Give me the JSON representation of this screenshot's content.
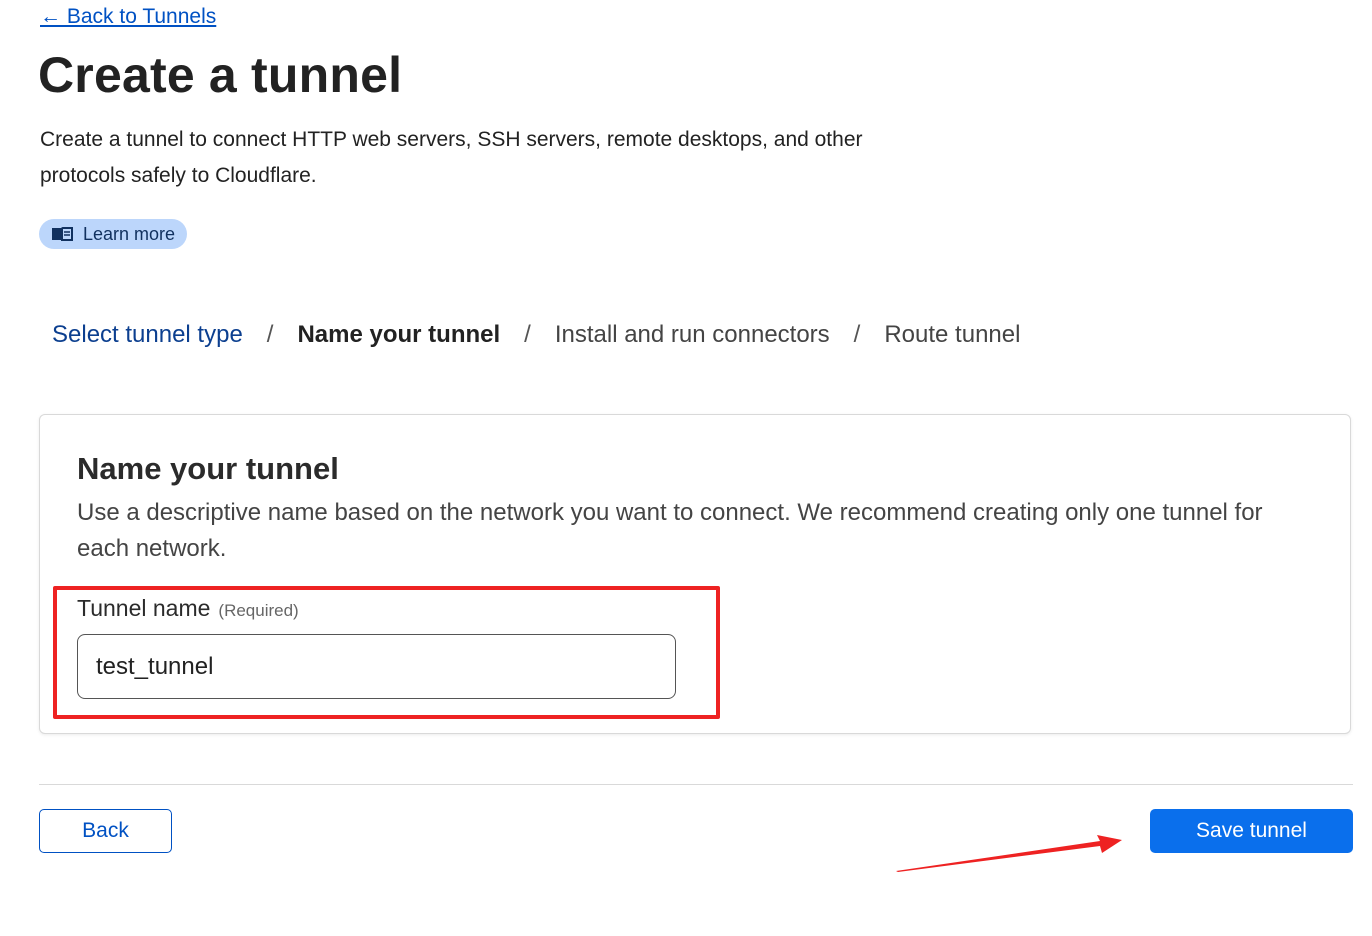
{
  "nav": {
    "back_link": "← Back to Tunnels"
  },
  "header": {
    "title": "Create a tunnel",
    "description": "Create a tunnel to connect HTTP web servers, SSH servers, remote desktops, and other protocols safely to Cloudflare.",
    "learn_more": "Learn more",
    "learn_more_icon": "book-icon"
  },
  "steps": {
    "items": [
      {
        "label": "Select tunnel type",
        "state": "completed"
      },
      {
        "label": "Name your tunnel",
        "state": "current"
      },
      {
        "label": "Install and run connectors",
        "state": "upcoming"
      },
      {
        "label": "Route tunnel",
        "state": "upcoming"
      }
    ],
    "separator": "/"
  },
  "card": {
    "title": "Name your tunnel",
    "description": "Use a descriptive name based on the network you want to connect. We recommend creating only one tunnel for each network.",
    "field": {
      "label": "Tunnel name",
      "required": "(Required)",
      "value": "test_tunnel"
    }
  },
  "footer": {
    "back_label": "Back",
    "save_label": "Save tunnel"
  },
  "colors": {
    "primary": "#0a6fec",
    "link": "#0051c3",
    "annotation": "#ee2222",
    "learn_more_bg": "#bcd6fb"
  }
}
